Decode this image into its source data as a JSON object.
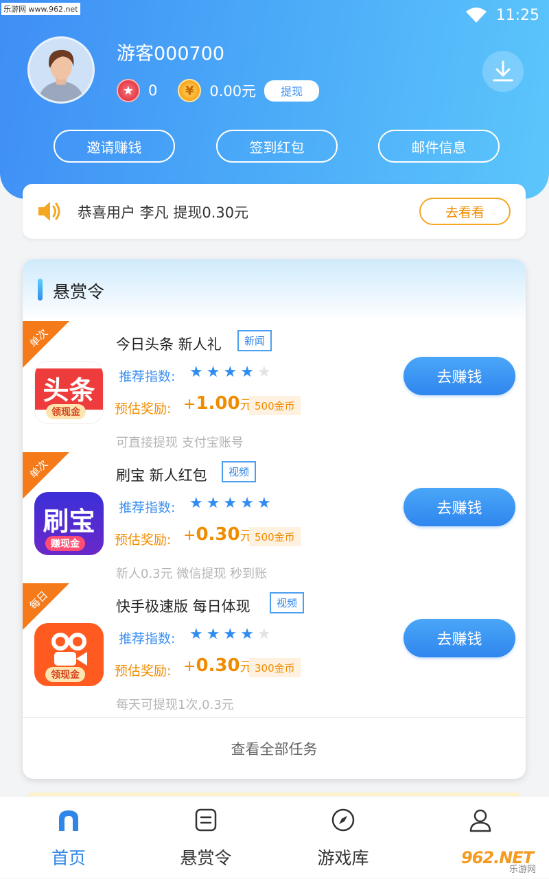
{
  "watermark_top": "乐游网 www.962.net",
  "status": {
    "time": "11:25"
  },
  "user": {
    "name": "游客000700",
    "stars": "0",
    "balance": "0.00元",
    "withdraw_label": "提现"
  },
  "header_buttons": [
    "邀请赚钱",
    "签到红包",
    "邮件信息"
  ],
  "notice": {
    "text": "恭喜用户 李凡 提现0.30元",
    "button": "去看看"
  },
  "bounty": {
    "title": "悬赏令",
    "tasks": [
      {
        "corner": "单次",
        "name": "今日头条 新人礼",
        "tag": "新闻",
        "icon_text": "头条",
        "icon_strip": "领现金",
        "rec_label": "推荐指数:",
        "rating": 4,
        "reward_label": "预估奖励:",
        "reward_plus": "+",
        "reward_num": "1.00",
        "reward_unit": "元",
        "coins": "500金币",
        "desc": "可直接提现 支付宝账号",
        "button": "去赚钱"
      },
      {
        "corner": "单次",
        "name": "刷宝 新人红包",
        "tag": "视频",
        "icon_text": "刷宝",
        "icon_strip": "赚现金",
        "rec_label": "推荐指数:",
        "rating": 5,
        "reward_label": "预估奖励:",
        "reward_plus": "+",
        "reward_num": "0.30",
        "reward_unit": "元",
        "coins": "500金币",
        "desc": "新人0.3元 微信提现 秒到账",
        "button": "去赚钱"
      },
      {
        "corner": "每日",
        "name": "快手极速版 每日体现",
        "tag": "视频",
        "icon_text": "",
        "icon_strip": "领现金",
        "rec_label": "推荐指数:",
        "rating": 4,
        "reward_label": "预估奖励:",
        "reward_plus": "+",
        "reward_num": "0.30",
        "reward_unit": "元",
        "coins": "300金币",
        "desc": "每天可提现1次,0.3元",
        "button": "去赚钱"
      }
    ],
    "view_all": "查看全部任务"
  },
  "tabs": [
    {
      "label": "首页",
      "icon": "home-icon"
    },
    {
      "label": "悬赏令",
      "icon": "list-icon"
    },
    {
      "label": "游戏库",
      "icon": "compass-icon"
    },
    {
      "label": "",
      "icon": "person-icon"
    }
  ],
  "watermark_bottom": {
    "logo": "962.NET",
    "sub": "乐游网"
  },
  "colors": {
    "primary": "#2f86ee",
    "accent": "#f08c00",
    "corner": "#f47a1a"
  }
}
